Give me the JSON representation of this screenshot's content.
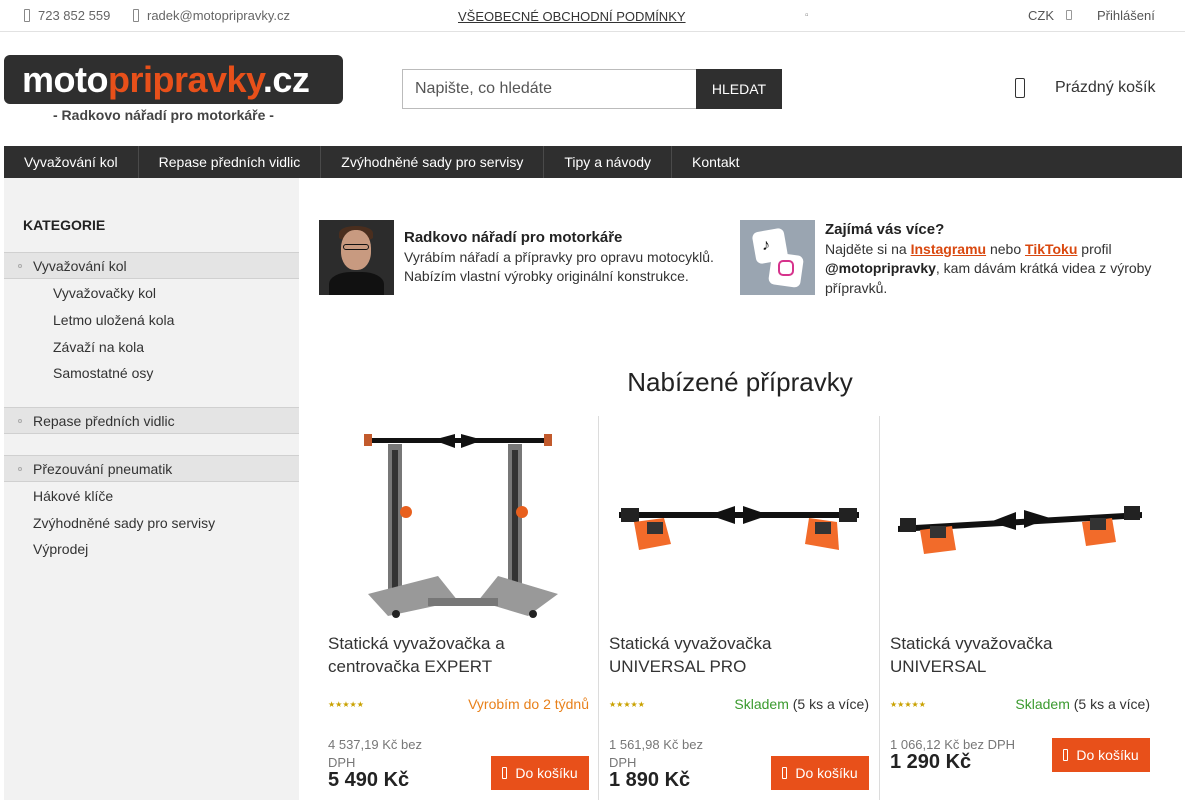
{
  "topbar": {
    "phone": "723 852 559",
    "email": "radek@motopripravky.cz",
    "terms": "VŠEOBECNÉ OBCHODNÍ PODMÍNKY",
    "currency": "CZK",
    "login": "Přihlášení"
  },
  "header": {
    "logo_main": "motopripravky",
    "logo_tld": ".cz",
    "tagline": "- Radkovo nářadí pro motorkáře -",
    "search_placeholder": "Napište, co hledáte",
    "search_button": "HLEDAT",
    "cart_label": "Prázdný košík"
  },
  "nav": {
    "items": [
      "Vyvažování kol",
      "Repase předních vidlic",
      "Zvýhodněné sady pro servisy",
      "Tipy a návody",
      "Kontakt"
    ]
  },
  "sidebar": {
    "heading": "KATEGORIE",
    "cat1": "Vyvažování kol",
    "cat1_subs": [
      "Vyvažovačky kol",
      "Letmo uložená kola",
      "Závaží na kola",
      "Samostatné osy"
    ],
    "cat2": "Repase předních vidlic",
    "cat3": "Přezouvání pneumatik",
    "others": [
      "Hákové klíče",
      "Zvýhodněné sady pro servisy",
      "Výprodej"
    ]
  },
  "info": {
    "about_title": "Radkovo nářadí pro motorkáře",
    "about_text": "Vyrábím nářadí a přípravky pro opravu motocyklů. Nabízím vlastní výrobky originální konstrukce.",
    "social_title": "Zajímá vás více?",
    "social_pre": "Najděte si na ",
    "social_instagram": "Instagramu",
    "social_mid": " nebo ",
    "social_tiktok": "TikToku",
    "social_post": " profil ",
    "social_handle": "@motopripravky",
    "social_tail": ", kam dávám krátká videa z výroby přípravků."
  },
  "section_title": "Nabízené přípravky",
  "products": [
    {
      "name": "Statická vyvažovačka a centrovačka EXPERT",
      "stars": "★★★★★",
      "availability": "Vyrobím do 2 týdnů",
      "availability_extra": "",
      "price_net": "4 537,19 Kč bez DPH",
      "price": "5 490 Kč",
      "buy_label": "Do košíku"
    },
    {
      "name": "Statická vyvažovačka UNIVERSAL PRO",
      "stars": "★★★★★",
      "availability": "Skladem",
      "availability_extra": " (5 ks a více)",
      "price_net": "1 561,98 Kč bez DPH",
      "price": "1 890 Kč",
      "buy_label": "Do košíku"
    },
    {
      "name": "Statická vyvažovačka UNIVERSAL",
      "stars": "★★★★★",
      "availability": "Skladem",
      "availability_extra": " (5 ks a více)",
      "price_net": "1 066,12 Kč bez DPH",
      "price": "1 290 Kč",
      "buy_label": "Do košíku"
    }
  ],
  "colors": {
    "accent": "#e8501a",
    "dark": "#2f2f2f",
    "in_stock": "#3a9a2e",
    "made_to_order": "#e8801a"
  }
}
